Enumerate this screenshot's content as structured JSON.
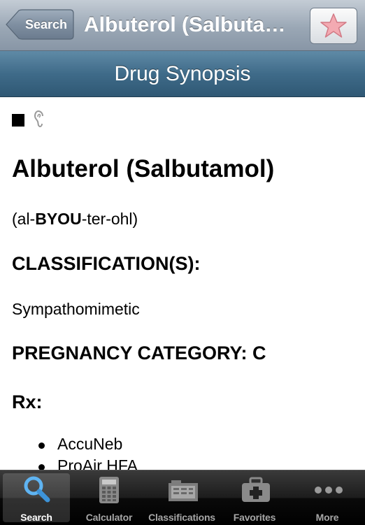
{
  "navbar": {
    "back_label": "Search",
    "title": "Albuterol (Salbutamol)",
    "favorite_icon": "star-icon"
  },
  "section": {
    "title": "Drug Synopsis"
  },
  "content": {
    "drug_name": "Albuterol (Salbutamol)",
    "pronunciation": {
      "before": "(al-",
      "stress": "BYOU",
      "after": "-ter-ohl)"
    },
    "classification_heading": "CLASSIFICATION(S):",
    "classification_value": "Sympathomimetic",
    "pregnancy_heading": "PREGNANCY CATEGORY: C",
    "rx_heading": "Rx:",
    "rx_items": [
      "AccuNeb",
      "ProAir HFA"
    ]
  },
  "tabbar": {
    "tabs": [
      {
        "label": "Search",
        "icon": "magnifier-icon",
        "selected": true
      },
      {
        "label": "Calculator",
        "icon": "calculator-icon",
        "selected": false
      },
      {
        "label": "Classifications",
        "icon": "classifications-icon",
        "selected": false
      },
      {
        "label": "Favorites",
        "icon": "first-aid-kit-icon",
        "selected": false
      },
      {
        "label": "More",
        "icon": "more-dots-icon",
        "selected": false
      }
    ]
  },
  "colors": {
    "navbar": "#9aa7b5",
    "section_bar": "#3f6b89",
    "selected_tab_icon": "#4aa3e8",
    "star": "#f0a0a8"
  }
}
